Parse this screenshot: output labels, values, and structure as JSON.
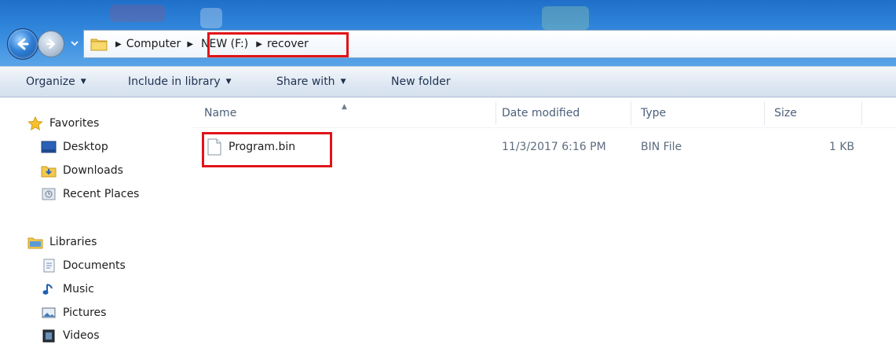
{
  "address": {
    "crumbs": [
      "Computer",
      "NEW (F:)",
      "recover"
    ]
  },
  "toolbar": {
    "organize": "Organize",
    "include_in_library": "Include in library",
    "share_with": "Share with",
    "new_folder": "New folder"
  },
  "nav": {
    "favorites": "Favorites",
    "desktop": "Desktop",
    "downloads": "Downloads",
    "recent_places": "Recent Places",
    "libraries": "Libraries",
    "documents": "Documents",
    "music": "Music",
    "pictures": "Pictures",
    "videos": "Videos"
  },
  "columns": {
    "name": "Name",
    "date_modified": "Date modified",
    "type": "Type",
    "size": "Size"
  },
  "files": [
    {
      "name": "Program.bin",
      "date_modified": "11/3/2017 6:16 PM",
      "type": "BIN File",
      "size": "1 KB"
    }
  ],
  "colors": {
    "highlight": "#e0141a",
    "titlebar": "#2d82d8"
  },
  "icons": {
    "back": "arrow-left-icon",
    "forward": "arrow-right-icon",
    "file": "file-icon",
    "folder": "folder-icon"
  }
}
